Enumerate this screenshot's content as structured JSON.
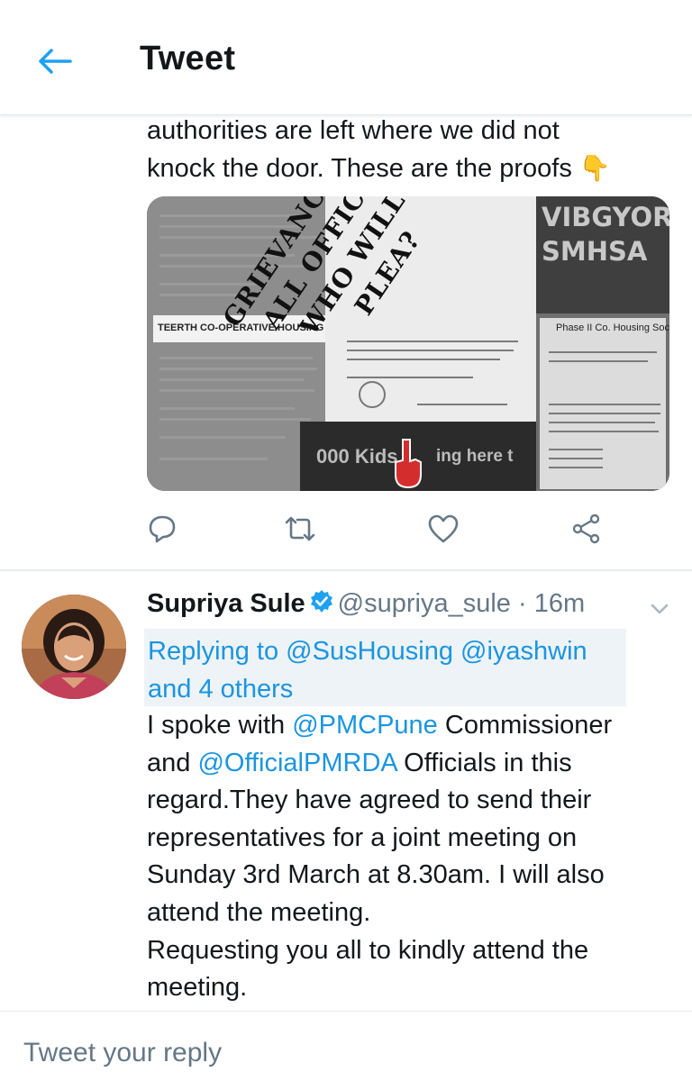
{
  "colors": {
    "accent": "#1b95e0",
    "text": "#14171a",
    "muted": "#657786",
    "verified": "#1da1f2",
    "reply_bg": "#edf3f7"
  },
  "header": {
    "title": "Tweet",
    "back_icon": "arrow-left-icon"
  },
  "previous_tweet": {
    "text_line1": "authorities are left where we did not",
    "text_line2": "knock the door. These are the proofs",
    "emoji": "👇",
    "media": {
      "overlay_lines": [
        "GRIEVANCES,",
        "ALL OFFICIALS",
        "WHO WILL LISTEN",
        "PLEA?"
      ],
      "banner_text": "TEERTH CO-OPERATIVE HOUSING SOCIETY LTD",
      "vib_line1": "VIBGYORR",
      "vib_line2": "SMHSA",
      "phase_text": "Phase II Co. Housing Society",
      "kids_text": "000 Kids",
      "here_text": "ing here t"
    },
    "actions": {
      "reply_icon": "reply-icon",
      "retweet_icon": "retweet-icon",
      "like_icon": "heart-icon",
      "share_icon": "share-icon"
    }
  },
  "reply_tweet": {
    "author_name": "Supriya Sule",
    "handle": "@supriya_sule",
    "separator": " · ",
    "time": "16m",
    "replying_prefix": "Replying to",
    "replying_mention1": "@SusHousing",
    "replying_mention2": "@iyashwin",
    "replying_others": "and 4 others",
    "body": {
      "l1_a": "I spoke with ",
      "l1_m": "@PMCPune",
      "l1_b": " Commissioner",
      "l2_a": "and ",
      "l2_m": "@OfficialPMRDA",
      "l2_b": " Officials in this",
      "l3": "regard.They have agreed to send their",
      "l4": "representatives for a joint meeting on",
      "l5": "Sunday 3rd March at 8.30am. I will also",
      "l6": "attend the meeting.",
      "l7": "Requesting you all to kindly attend the",
      "l8": "meeting."
    }
  },
  "reply_box": {
    "placeholder": "Tweet your reply"
  }
}
